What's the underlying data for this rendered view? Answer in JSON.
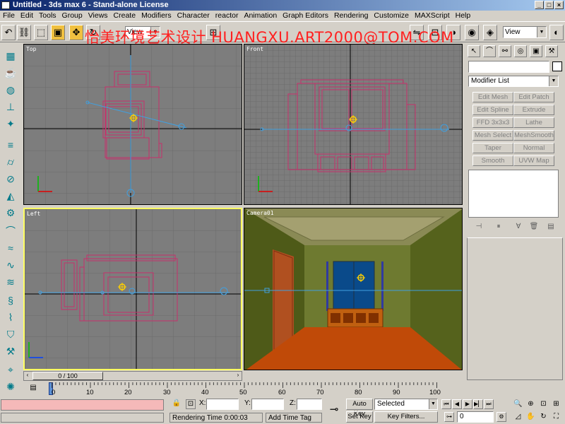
{
  "window": {
    "title": "Untitled - 3ds max 6 - Stand-alone License",
    "minimize": "_",
    "maximize": "□",
    "close": "×"
  },
  "menu": [
    "File",
    "Edit",
    "Tools",
    "Group",
    "Views",
    "Create",
    "Modifiers",
    "Character",
    "reactor",
    "Animation",
    "Graph Editors",
    "Rendering",
    "Customize",
    "MAXScript",
    "Help"
  ],
  "toolbar": {
    "ref_coord": "View",
    "named_selection": "View",
    "watermark": "怡美环境艺术设计 HUANGXU.ART2000@TOM.COM"
  },
  "viewports": {
    "top": "Top",
    "front": "Front",
    "left": "Left",
    "camera": "Camera01"
  },
  "timeline": {
    "slider": "0 / 100",
    "ticks": [
      "0",
      "10",
      "20",
      "30",
      "40",
      "50",
      "60",
      "70",
      "80",
      "90",
      "100"
    ]
  },
  "command_panel": {
    "modifier_list": "Modifier List",
    "buttons": [
      "Edit Mesh",
      "Edit Patch",
      "Edit Spline",
      "Extrude",
      "FFD 3x3x3",
      "Lathe",
      "Mesh Select",
      "MeshSmooth",
      "Taper",
      "Normal",
      "Smooth",
      "UVW Map"
    ]
  },
  "status": {
    "x_label": "X:",
    "y_label": "Y:",
    "z_label": "Z:",
    "rendering_time": "Rendering Time  0:00:03",
    "add_time_tag": "Add Time Tag",
    "auto_key": "Auto Key",
    "set_key": "Set Key",
    "selected": "Selected",
    "key_filters": "Key Filters...",
    "frame": "0"
  },
  "colors": {
    "wire": "#c8306a",
    "light": "#40a0e0",
    "viewport_bg": "#7d7d7d",
    "active_border": "#ffff60"
  }
}
